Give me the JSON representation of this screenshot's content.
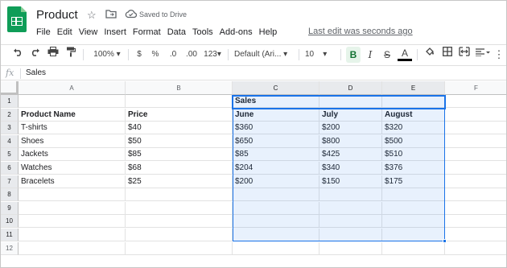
{
  "app": {
    "doc_title": "Product",
    "saved_status": "Saved to Drive",
    "last_edit": "Last edit was seconds ago",
    "icons": [
      "star-icon",
      "move-to-folder-icon",
      "cloud-saved-icon"
    ]
  },
  "menu": [
    "File",
    "Edit",
    "View",
    "Insert",
    "Format",
    "Data",
    "Tools",
    "Add-ons",
    "Help"
  ],
  "toolbar": {
    "zoom": "100%",
    "currency": "$",
    "percent": "%",
    "decrease_decimal": ".0",
    "increase_decimal": ".00",
    "more_formats": "123",
    "font": "Default (Ari...",
    "font_size": "10",
    "bold": "B",
    "italic": "I",
    "strikethrough": "S",
    "text_color": "A"
  },
  "formula_bar": {
    "fx": "fx",
    "value": "Sales"
  },
  "columns": [
    "A",
    "B",
    "C",
    "D",
    "E",
    "F"
  ],
  "rows": [
    "1",
    "2",
    "3",
    "4",
    "5",
    "6",
    "7",
    "8",
    "9",
    "10",
    "11",
    "12"
  ],
  "cells": {
    "C1": "Sales",
    "A2": "Product Name",
    "B2": "Price",
    "C2": "June",
    "D2": "July",
    "E2": "August",
    "A3": "T-shirts",
    "B3": "$40",
    "C3": "$360",
    "D3": "$200",
    "E3": "$320",
    "A4": "Shoes",
    "B4": "$50",
    "C4": "$650",
    "D4": "$800",
    "E4": "$500",
    "A5": "Jackets",
    "B5": "$85",
    "C5": "$85",
    "D5": "$425",
    "E5": "$510",
    "A6": "Watches",
    "B6": "$68",
    "C6": "$204",
    "D6": "$340",
    "E6": "$376",
    "A7": "Bracelets",
    "B7": "$25",
    "C7": "$200",
    "D7": "$150",
    "E7": "$175"
  },
  "colors": {
    "accent": "#1a73e8",
    "logo": "#0f9d58",
    "bold_active": "#e6f4ea"
  }
}
